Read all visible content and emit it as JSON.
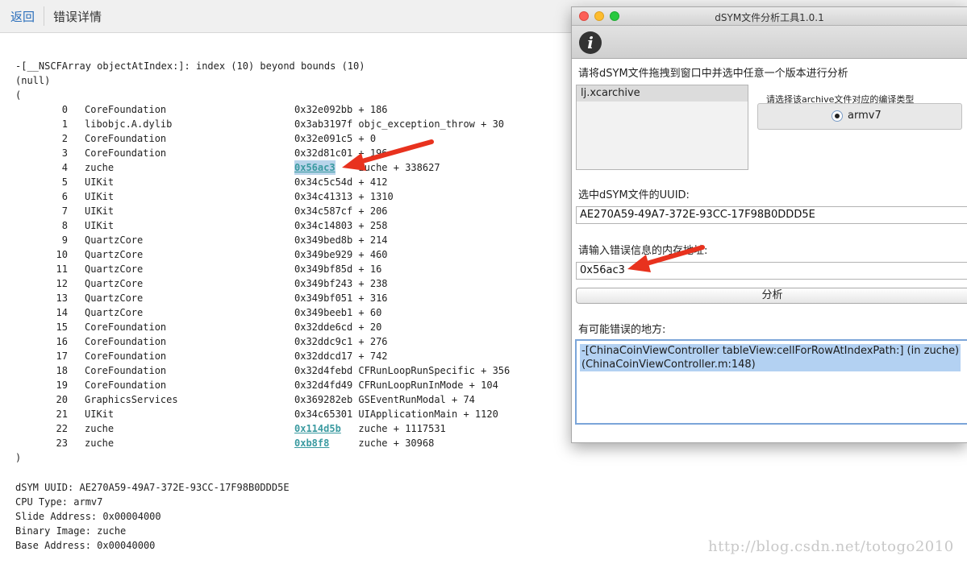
{
  "topbar": {
    "back": "返回",
    "title": "错误详情"
  },
  "log": {
    "header": [
      "-[__NSCFArray objectAtIndex:]: index (10) beyond bounds (10)",
      "(null)",
      "("
    ],
    "frames": [
      {
        "idx": "0",
        "lib": "CoreFoundation",
        "addr": "0x32e092bb",
        "sym": "+ 186"
      },
      {
        "idx": "1",
        "lib": "libobjc.A.dylib",
        "addr": "0x3ab3197f",
        "sym": "objc_exception_throw + 30"
      },
      {
        "idx": "2",
        "lib": "CoreFoundation",
        "addr": "0x32e091c5",
        "sym": "+ 0"
      },
      {
        "idx": "3",
        "lib": "CoreFoundation",
        "addr": "0x32d81c01",
        "sym": "+ 196"
      },
      {
        "idx": "4",
        "lib": "zuche",
        "addr": "0x56ac3",
        "sym": "zuche + 338627",
        "link": true,
        "selected": true
      },
      {
        "idx": "5",
        "lib": "UIKit",
        "addr": "0x34c5c54d",
        "sym": "+ 412"
      },
      {
        "idx": "6",
        "lib": "UIKit",
        "addr": "0x34c41313",
        "sym": "+ 1310"
      },
      {
        "idx": "7",
        "lib": "UIKit",
        "addr": "0x34c587cf",
        "sym": "+ 206"
      },
      {
        "idx": "8",
        "lib": "UIKit",
        "addr": "0x34c14803",
        "sym": "+ 258"
      },
      {
        "idx": "9",
        "lib": "QuartzCore",
        "addr": "0x349bed8b",
        "sym": "+ 214"
      },
      {
        "idx": "10",
        "lib": "QuartzCore",
        "addr": "0x349be929",
        "sym": "+ 460"
      },
      {
        "idx": "11",
        "lib": "QuartzCore",
        "addr": "0x349bf85d",
        "sym": "+ 16"
      },
      {
        "idx": "12",
        "lib": "QuartzCore",
        "addr": "0x349bf243",
        "sym": "+ 238"
      },
      {
        "idx": "13",
        "lib": "QuartzCore",
        "addr": "0x349bf051",
        "sym": "+ 316"
      },
      {
        "idx": "14",
        "lib": "QuartzCore",
        "addr": "0x349beeb1",
        "sym": "+ 60"
      },
      {
        "idx": "15",
        "lib": "CoreFoundation",
        "addr": "0x32dde6cd",
        "sym": "+ 20"
      },
      {
        "idx": "16",
        "lib": "CoreFoundation",
        "addr": "0x32ddc9c1",
        "sym": "+ 276"
      },
      {
        "idx": "17",
        "lib": "CoreFoundation",
        "addr": "0x32ddcd17",
        "sym": "+ 742"
      },
      {
        "idx": "18",
        "lib": "CoreFoundation",
        "addr": "0x32d4febd",
        "sym": "CFRunLoopRunSpecific + 356"
      },
      {
        "idx": "19",
        "lib": "CoreFoundation",
        "addr": "0x32d4fd49",
        "sym": "CFRunLoopRunInMode + 104"
      },
      {
        "idx": "20",
        "lib": "GraphicsServices",
        "addr": "0x369282eb",
        "sym": "GSEventRunModal + 74"
      },
      {
        "idx": "21",
        "lib": "UIKit",
        "addr": "0x34c65301",
        "sym": "UIApplicationMain + 1120"
      },
      {
        "idx": "22",
        "lib": "zuche",
        "addr": "0x114d5b",
        "sym": "zuche + 1117531",
        "link": true
      },
      {
        "idx": "23",
        "lib": "zuche",
        "addr": "0xb8f8",
        "sym": "zuche + 30968",
        "link": true
      }
    ],
    "close": ")",
    "info": [
      "dSYM UUID: AE270A59-49A7-372E-93CC-17F98B0DDD5E",
      "CPU Type: armv7",
      "Slide Address: 0x00004000",
      "Binary Image: zuche",
      "Base Address: 0x00040000"
    ]
  },
  "watermark": "http://blog.csdn.net/totogo2010",
  "tool": {
    "window_title": "dSYM文件分析工具1.0.1",
    "info_icon": "i",
    "instruction": "请将dSYM文件拖拽到窗口中并选中任意一个版本进行分析",
    "archives": [
      "lj.xcarchive"
    ],
    "build_type_label": "请选择该archive文件对应的编译类型",
    "build_type": "armv7",
    "uuid_label": "选中dSYM文件的UUID:",
    "uuid_value": "AE270A59-49A7-372E-93CC-17F98B0DDD5E",
    "address_label": "请输入错误信息的内存地址:",
    "address_value": "0x56ac3",
    "analyze_button": "分析",
    "result_label": "有可能错误的地方:",
    "result_text": "-[ChinaCoinViewController tableView:cellForRowAtIndexPath:] (in zuche)\n(ChinaCoinViewController.m:148)"
  },
  "colors": {
    "link": "#3a9aa0",
    "selection": "#b3d1f2",
    "arrow": "#e8321e",
    "focus_ring": "#7ba5d9"
  },
  "icons": {
    "info": "info-icon",
    "arrow": "red-arrow-annotation"
  }
}
